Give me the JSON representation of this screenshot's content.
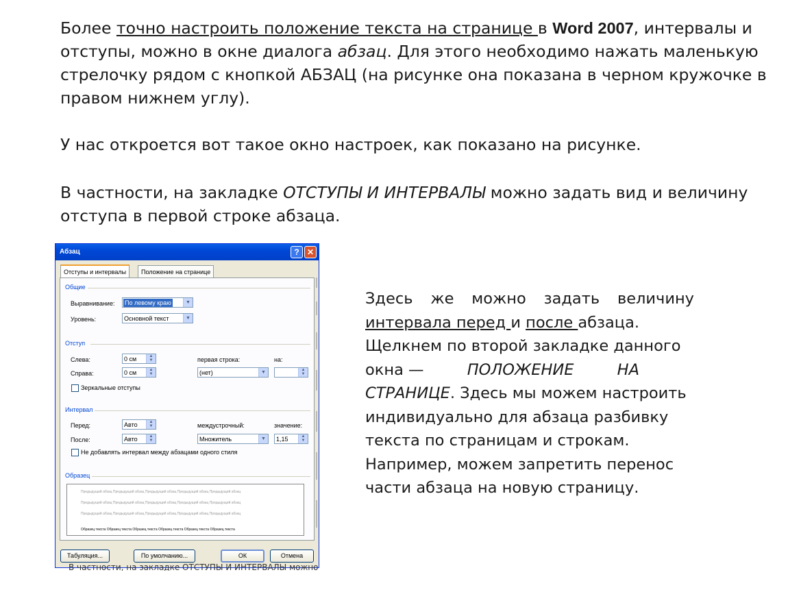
{
  "paragraph1": {
    "p1": "Более ",
    "underlined": "точно настроить положение текста на странице ",
    "p2": "в ",
    "bold": "Word 2007",
    "p3": ", интервалы и",
    "line2a": "отступы, можно в окне диалога ",
    "italic": "абзац",
    "line2b": ". Для этого необходимо нажать маленькую",
    "line3": "стрелочку рядом с кнопкой АБЗАЦ (на рисунке она показана в черном кружочке в",
    "line4": "правом нижнем углу)."
  },
  "paragraph2": "У нас откроется вот такое окно настроек, как показано на рисунке.",
  "paragraph3": {
    "p1": "В частности, на закладке ",
    "italic": "ОТСТУПЫ И ИНТЕРВАЛЫ",
    "p2": " можно задать вид и величину",
    "line2": "отступа в первой строке абзаца."
  },
  "side_text": {
    "l1": [
      "Здесь",
      "же",
      "можно",
      "задать",
      "величину"
    ],
    "l2_u1": "интервала перед ",
    "l2_and": "и ",
    "l2_u2": "после ",
    "l2_end": "абзаца.",
    "l3": "Щелкнем по второй закладке данного",
    "l4a": "окна —",
    "l4b": "ПОЛОЖЕНИЕ",
    "l4c": "НА",
    "l5a": "СТРАНИЦЕ",
    "l5b": ". Здесь мы можем настроить",
    "l6": "индивидуально для абзаца разбивку",
    "l7": "текста по страницам и строкам.",
    "l8": "Например, можем запретить перенос",
    "l9": "части абзаца на новую страницу."
  },
  "dialog": {
    "title": "Абзац",
    "help": "?",
    "close": "✕",
    "tabs": [
      "Отступы и интервалы",
      "Положение на странице"
    ],
    "general": {
      "header": "Общие",
      "align_label": "Выравнивание:",
      "align_value": "По левому краю",
      "level_label": "Уровень:",
      "level_value": "Основной текст"
    },
    "indent": {
      "header": "Отступ",
      "left_label": "Слева:",
      "left_value": "0 см",
      "right_label": "Справа:",
      "right_value": "0 см",
      "first_label": "первая строка:",
      "first_value": "(нет)",
      "by_label": "на:",
      "mirror_label": "Зеркальные отступы"
    },
    "spacing": {
      "header": "Интервал",
      "before_label": "Перед:",
      "before_value": "Авто",
      "after_label": "После:",
      "after_value": "Авто",
      "line_label": "междустрочный:",
      "line_value": "Множитель",
      "value_label": "значение:",
      "value_value": "1,15",
      "nospace_label": "Не добавлять интервал между абзацами одного стиля"
    },
    "preview": {
      "header": "Образец",
      "grey": "Предыдущий абзац Предыдущий абзац Предыдущий абзац Предыдущий абзац Предыдущий абзац",
      "sample": "Образец текста Образец текста Образец текста Образец текста Образец текста Образец текста"
    },
    "buttons": {
      "tabs": "Табуляция...",
      "default": "По умолчанию...",
      "ok": "ОК",
      "cancel": "Отмена"
    }
  },
  "bleed_text": "В частности, на закладке ОТСТУПЫ И ИНТЕРВАЛЫ можно"
}
